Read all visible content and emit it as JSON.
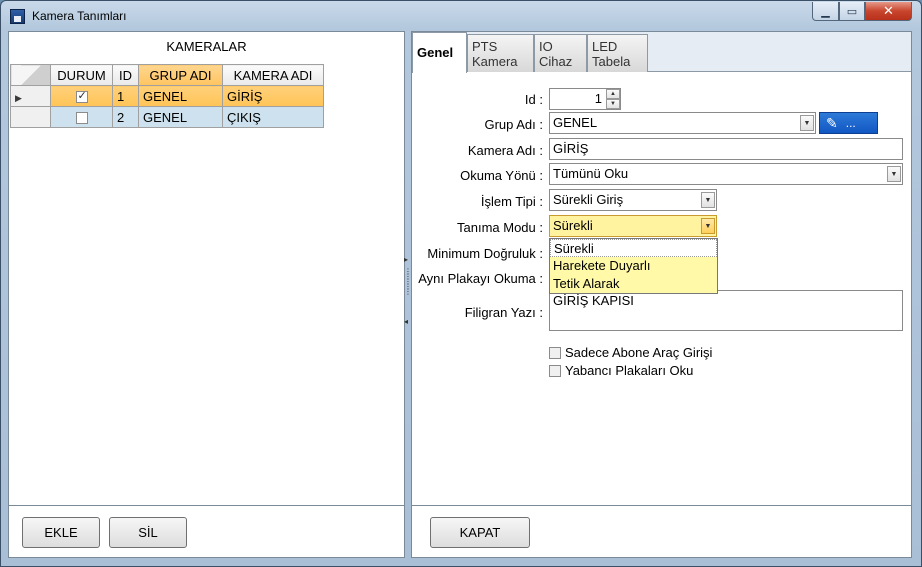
{
  "window": {
    "title": "Kamera Tanımları"
  },
  "left": {
    "title": "KAMERALAR",
    "columns": [
      "DURUM",
      "ID",
      "GRUP ADI",
      "KAMERA ADI"
    ],
    "rows": [
      {
        "durum": true,
        "id": "1",
        "grup": "GENEL",
        "kamera": "GİRİŞ"
      },
      {
        "durum": false,
        "id": "2",
        "grup": "GENEL",
        "kamera": "ÇIKIŞ"
      }
    ],
    "add_label": "EKLE",
    "delete_label": "SİL"
  },
  "tabs": [
    {
      "label": "Genel"
    },
    {
      "label": "PTS Kamera"
    },
    {
      "label": "IO Cihaz"
    },
    {
      "label": "LED Tabela"
    }
  ],
  "form": {
    "id_label": "Id :",
    "id_value": "1",
    "group_label": "Grup Adı :",
    "group_value": "GENEL",
    "group_edit": "...",
    "camera_label": "Kamera Adı :",
    "camera_value": "GİRİŞ",
    "direction_label": "Okuma Yönü :",
    "direction_value": "Tümünü Oku",
    "process_label": "İşlem Tipi :",
    "process_value": "Sürekli Giriş",
    "mode_label": "Tanıma Modu :",
    "mode_value": "Sürekli",
    "mode_options": [
      "Sürekli",
      "Harekete Duyarlı",
      "Tetik Alarak"
    ],
    "accuracy_label": "Minimum Doğruluk :",
    "same_plate_label": "Aynı Plakayı Okuma :",
    "watermark_label": "Filigran Yazı :",
    "watermark_value": "GİRİŞ KAPISI",
    "subscriber_only": "Sadece Abone Araç Girişi",
    "foreign_plates": "Yabancı Plakaları Oku"
  },
  "close_label": "KAPAT"
}
